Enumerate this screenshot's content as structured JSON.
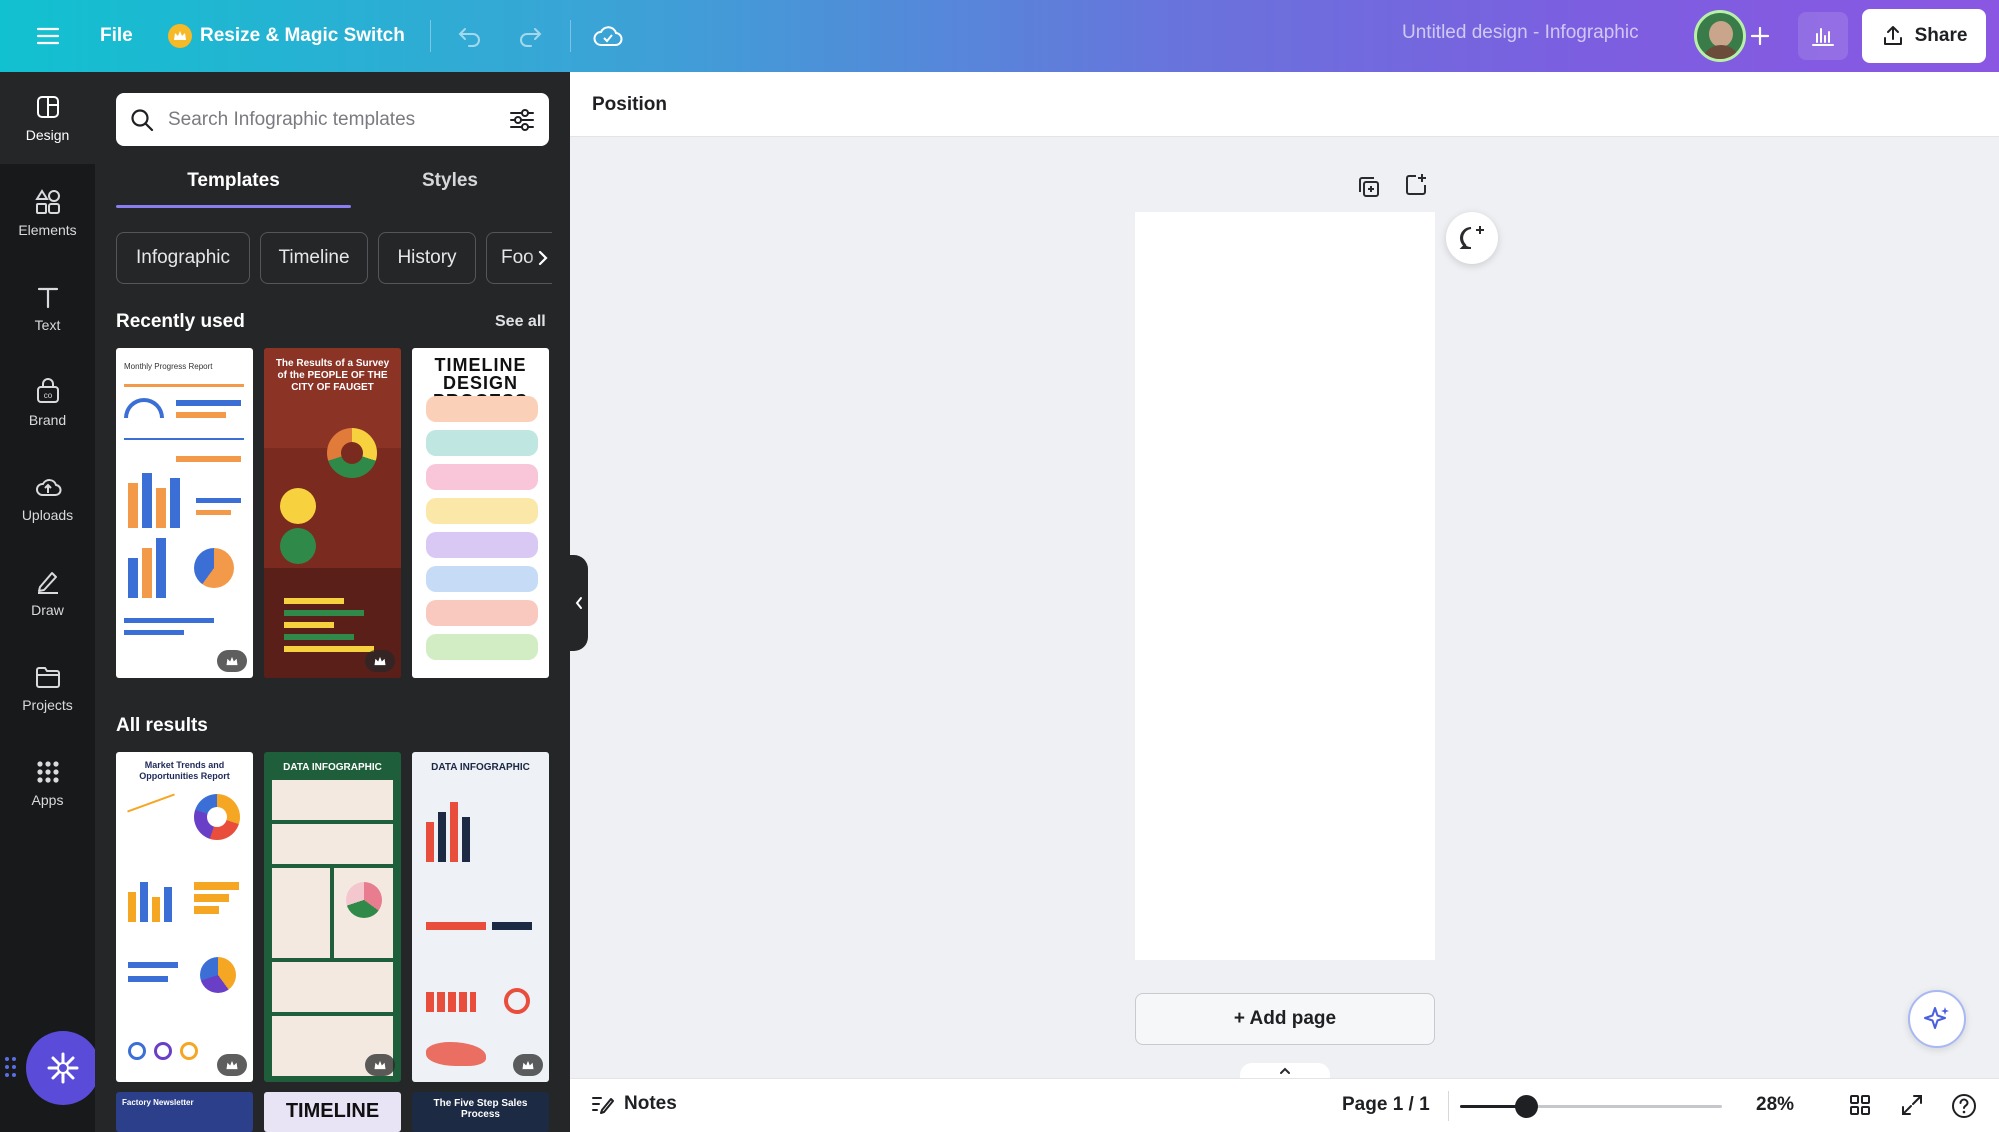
{
  "topbar": {
    "file_label": "File",
    "resize_label": "Resize & Magic Switch",
    "design_title": "Untitled design - Infographic",
    "share_label": "Share"
  },
  "sidebar": {
    "items": [
      {
        "label": "Design",
        "icon": "design-icon"
      },
      {
        "label": "Elements",
        "icon": "elements-icon"
      },
      {
        "label": "Text",
        "icon": "text-icon"
      },
      {
        "label": "Brand",
        "icon": "brand-icon"
      },
      {
        "label": "Uploads",
        "icon": "uploads-icon"
      },
      {
        "label": "Draw",
        "icon": "draw-icon"
      },
      {
        "label": "Projects",
        "icon": "projects-icon"
      },
      {
        "label": "Apps",
        "icon": "apps-icon"
      }
    ]
  },
  "panel": {
    "search_placeholder": "Search Infographic templates",
    "tabs": [
      "Templates",
      "Styles"
    ],
    "chips": [
      "Infographic",
      "Timeline",
      "History",
      "Foo"
    ],
    "recently_used": "Recently used",
    "see_all": "See all",
    "all_results": "All results",
    "recent_templates": [
      {
        "title": "Monthly Progress Report",
        "bg": "#ffffff",
        "premium": true
      },
      {
        "title": "The Results of a Survey of the PEOPLE OF THE CITY OF FAUGET",
        "bg": "#7a2a1f",
        "premium": true
      },
      {
        "title": "TIMELINE DESIGN PROCESS",
        "bg": "#ffffff",
        "premium": false
      }
    ],
    "result_templates": [
      {
        "title": "Market Trends and Opportunities Report",
        "bg": "#ffffff",
        "premium": true
      },
      {
        "title": "DATA INFOGRAPHIC",
        "bg": "#1f5e3a",
        "premium": true
      },
      {
        "title": "DATA INFOGRAPHIC",
        "bg": "#eef1f6",
        "premium": true
      }
    ],
    "more_templates": [
      {
        "title": "Factory Newsletter",
        "bg": "#2b3f8a"
      },
      {
        "title": "TIMELINE",
        "bg": "#e9e4f5"
      },
      {
        "title": "The Five Step Sales Process",
        "bg": "#1d2a44"
      }
    ]
  },
  "canvas": {
    "position_label": "Position",
    "add_page_label": "+ Add page"
  },
  "bottombar": {
    "notes_label": "Notes",
    "page_indicator": "Page 1 / 1",
    "zoom_level": "28%",
    "zoom_fraction": 0.28
  }
}
